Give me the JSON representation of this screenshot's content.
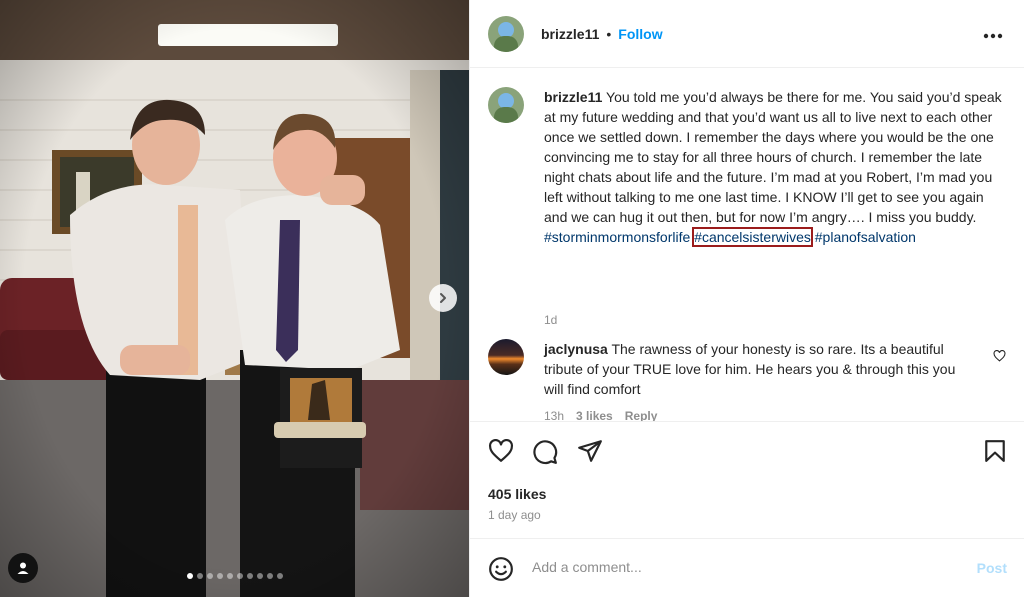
{
  "header": {
    "username": "brizzle11",
    "separator": "•",
    "follow_label": "Follow",
    "more_icon": "more-horizontal-icon"
  },
  "caption": {
    "username": "brizzle11",
    "text": " You told me you’d always be there for me. You said you’d speak at my future wedding and that you’d want us all to live next to each other once we settled down. I remember the days where you would be the one convincing me to stay for all three hours of church. I remember the late night chats about life and the future. I’m mad at you Robert, I’m mad you left without talking to me one last time. I KNOW I’ll get to see you again and we can hug it out then, but for now I’m angry…. I miss you buddy. ",
    "hashtags": [
      "#storminmormonsforlife",
      "#cancelsisterwives",
      "#planofsalvation"
    ],
    "time": "1d"
  },
  "comment": {
    "username": "jaclynusa",
    "text": " The rawness of your honesty is so rare. Its a beautiful tribute of your TRUE love for him. He hears you & through this you will find comfort",
    "time": "13h",
    "likes": "3 likes",
    "reply": "Reply"
  },
  "stats": {
    "likes": "405 likes",
    "date": "1 day ago"
  },
  "add_comment": {
    "placeholder": "Add a comment...",
    "post_label": "Post"
  },
  "carousel": {
    "total": 10,
    "active": 1
  },
  "colors": {
    "accent": "#0095f6",
    "hashtag": "#00376b",
    "highlight_box": "#9b1c1c",
    "muted": "#8e8e8e"
  }
}
